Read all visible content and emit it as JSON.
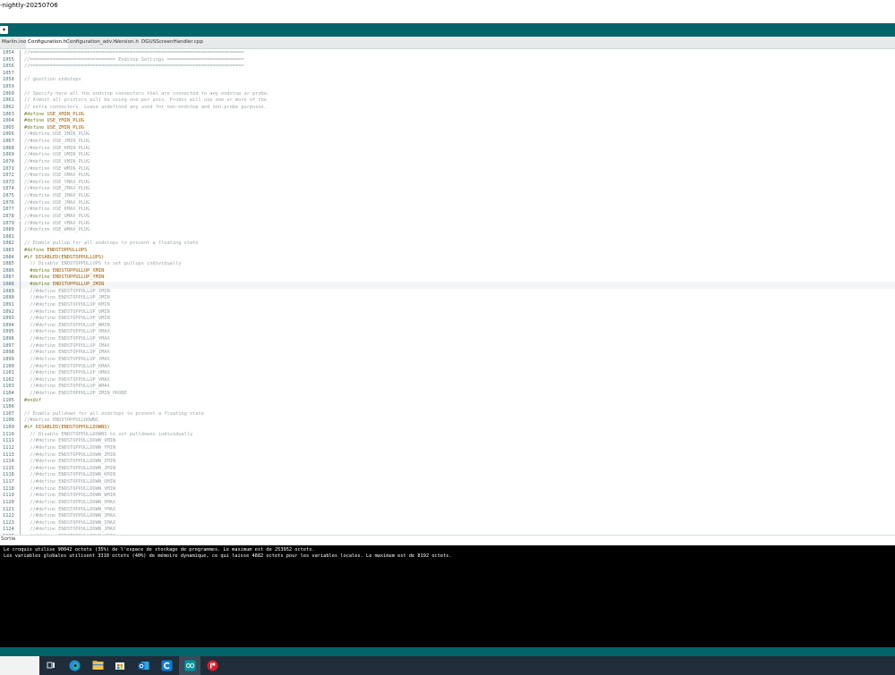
{
  "window": {
    "title": "-nightly-20250706"
  },
  "tabs": [
    {
      "label": "Marlin.ino",
      "active": false
    },
    {
      "label": "Configuration.h",
      "active": true
    },
    {
      "label": "Configuration_adv.h",
      "active": false
    },
    {
      "label": "Version.h",
      "active": false
    },
    {
      "label": "DGUSScreenHandler.cpp",
      "active": false
    }
  ],
  "editor": {
    "highlighted_line": 1088,
    "lines": [
      {
        "n": "1054",
        "text": "//===========================================================================",
        "kind": "cmt"
      },
      {
        "n": "1055",
        "text": "//============================== Endstop Settings ===========================",
        "kind": "cmt"
      },
      {
        "n": "1056",
        "text": "//===========================================================================",
        "kind": "cmt"
      },
      {
        "n": "1057",
        "text": "",
        "kind": "cmt"
      },
      {
        "n": "1058",
        "text": "// @section endstops",
        "kind": "cmt"
      },
      {
        "n": "1059",
        "text": "",
        "kind": "cmt"
      },
      {
        "n": "1060",
        "text": "// Specify here all the endstop connectors that are connected to any endstop or probe.",
        "kind": "cmt"
      },
      {
        "n": "1061",
        "text": "// Almost all printers will be using one per axis. Probes will use one or more of the",
        "kind": "cmt"
      },
      {
        "n": "1062",
        "text": "// extra connectors. Leave undefined any used for non-endstop and non-probe purposes.",
        "kind": "cmt"
      },
      {
        "n": "1063",
        "text": "#define USE_XMIN_PLUG",
        "kind": "def"
      },
      {
        "n": "1064",
        "text": "#define USE_YMIN_PLUG",
        "kind": "def"
      },
      {
        "n": "1065",
        "text": "#define USE_ZMIN_PLUG",
        "kind": "def"
      },
      {
        "n": "1066",
        "text": "//#define USE_IMIN_PLUG",
        "kind": "cmt"
      },
      {
        "n": "1067",
        "text": "//#define USE_JMIN_PLUG",
        "kind": "cmt"
      },
      {
        "n": "1068",
        "text": "//#define USE_KMIN_PLUG",
        "kind": "cmt"
      },
      {
        "n": "1069",
        "text": "//#define USE_UMIN_PLUG",
        "kind": "cmt"
      },
      {
        "n": "1070",
        "text": "//#define USE_VMIN_PLUG",
        "kind": "cmt"
      },
      {
        "n": "1071",
        "text": "//#define USE_WMIN_PLUG",
        "kind": "cmt"
      },
      {
        "n": "1072",
        "text": "//#define USE_XMAX_PLUG",
        "kind": "cmt"
      },
      {
        "n": "1073",
        "text": "//#define USE_YMAX_PLUG",
        "kind": "cmt"
      },
      {
        "n": "1074",
        "text": "//#define USE_ZMAX_PLUG",
        "kind": "cmt"
      },
      {
        "n": "1075",
        "text": "//#define USE_IMAX_PLUG",
        "kind": "cmt"
      },
      {
        "n": "1076",
        "text": "//#define USE_JMAX_PLUG",
        "kind": "cmt"
      },
      {
        "n": "1077",
        "text": "//#define USE_KMAX_PLUG",
        "kind": "cmt"
      },
      {
        "n": "1078",
        "text": "//#define USE_UMAX_PLUG",
        "kind": "cmt"
      },
      {
        "n": "1079",
        "text": "//#define USE_VMAX_PLUG",
        "kind": "cmt"
      },
      {
        "n": "1080",
        "text": "//#define USE_WMAX_PLUG",
        "kind": "cmt"
      },
      {
        "n": "1081",
        "text": "",
        "kind": "cmt"
      },
      {
        "n": "1082",
        "text": "// Enable pullup for all endstops to prevent a floating state",
        "kind": "cmt"
      },
      {
        "n": "1083",
        "text": "#define ENDSTOPPULLUPS",
        "kind": "def"
      },
      {
        "n": "1084",
        "text": "#if DISABLED(ENDSTOPPULLUPS)",
        "kind": "def"
      },
      {
        "n": "1085",
        "text": "  // Disable ENDSTOPPULLUPS to set pullups individually",
        "kind": "cmt"
      },
      {
        "n": "1086",
        "text": "  #define ENDSTOPPULLUP_XMIN",
        "kind": "def"
      },
      {
        "n": "1087",
        "text": "  #define ENDSTOPPULLUP_YMIN",
        "kind": "def"
      },
      {
        "n": "1088",
        "text": "  #define ENDSTOPPULLUP_ZMIN",
        "kind": "def"
      },
      {
        "n": "1089",
        "text": "  //#define ENDSTOPPULLUP_IMIN",
        "kind": "cmt"
      },
      {
        "n": "1090",
        "text": "  //#define ENDSTOPPULLUP_JMIN",
        "kind": "cmt"
      },
      {
        "n": "1091",
        "text": "  //#define ENDSTOPPULLUP_KMIN",
        "kind": "cmt"
      },
      {
        "n": "1092",
        "text": "  //#define ENDSTOPPULLUP_UMIN",
        "kind": "cmt"
      },
      {
        "n": "1093",
        "text": "  //#define ENDSTOPPULLUP_VMIN",
        "kind": "cmt"
      },
      {
        "n": "1094",
        "text": "  //#define ENDSTOPPULLUP_WMIN",
        "kind": "cmt"
      },
      {
        "n": "1095",
        "text": "  //#define ENDSTOPPULLUP_XMAX",
        "kind": "cmt"
      },
      {
        "n": "1096",
        "text": "  //#define ENDSTOPPULLUP_YMAX",
        "kind": "cmt"
      },
      {
        "n": "1097",
        "text": "  //#define ENDSTOPPULLUP_ZMAX",
        "kind": "cmt"
      },
      {
        "n": "1098",
        "text": "  //#define ENDSTOPPULLUP_IMAX",
        "kind": "cmt"
      },
      {
        "n": "1099",
        "text": "  //#define ENDSTOPPULLUP_JMAX",
        "kind": "cmt"
      },
      {
        "n": "1100",
        "text": "  //#define ENDSTOPPULLUP_KMAX",
        "kind": "cmt"
      },
      {
        "n": "1101",
        "text": "  //#define ENDSTOPPULLUP_UMAX",
        "kind": "cmt"
      },
      {
        "n": "1102",
        "text": "  //#define ENDSTOPPULLUP_VMAX",
        "kind": "cmt"
      },
      {
        "n": "1103",
        "text": "  //#define ENDSTOPPULLUP_WMAX",
        "kind": "cmt"
      },
      {
        "n": "1104",
        "text": "  //#define ENDSTOPPULLUP_ZMIN_PROBE",
        "kind": "cmt"
      },
      {
        "n": "1105",
        "text": "#endif",
        "kind": "def"
      },
      {
        "n": "1106",
        "text": "",
        "kind": "cmt"
      },
      {
        "n": "1107",
        "text": "// Enable pulldown for all endstops to prevent a floating state",
        "kind": "cmt"
      },
      {
        "n": "1108",
        "text": "//#define ENDSTOPPULLDOWNS",
        "kind": "cmt"
      },
      {
        "n": "1109",
        "text": "#if DISABLED(ENDSTOPPULLDOWNS)",
        "kind": "def"
      },
      {
        "n": "1110",
        "text": "  // Disable ENDSTOPPULLDOWNS to set pulldowns individually",
        "kind": "cmt"
      },
      {
        "n": "1111",
        "text": "  //#define ENDSTOPPULLDOWN_XMIN",
        "kind": "cmt"
      },
      {
        "n": "1112",
        "text": "  //#define ENDSTOPPULLDOWN_YMIN",
        "kind": "cmt"
      },
      {
        "n": "1113",
        "text": "  //#define ENDSTOPPULLDOWN_ZMIN",
        "kind": "cmt"
      },
      {
        "n": "1114",
        "text": "  //#define ENDSTOPPULLDOWN_IMIN",
        "kind": "cmt"
      },
      {
        "n": "1115",
        "text": "  //#define ENDSTOPPULLDOWN_JMIN",
        "kind": "cmt"
      },
      {
        "n": "1116",
        "text": "  //#define ENDSTOPPULLDOWN_KMIN",
        "kind": "cmt"
      },
      {
        "n": "1117",
        "text": "  //#define ENDSTOPPULLDOWN_UMIN",
        "kind": "cmt"
      },
      {
        "n": "1118",
        "text": "  //#define ENDSTOPPULLDOWN_VMIN",
        "kind": "cmt"
      },
      {
        "n": "1119",
        "text": "  //#define ENDSTOPPULLDOWN_WMIN",
        "kind": "cmt"
      },
      {
        "n": "1120",
        "text": "  //#define ENDSTOPPULLDOWN_XMAX",
        "kind": "cmt"
      },
      {
        "n": "1121",
        "text": "  //#define ENDSTOPPULLDOWN_YMAX",
        "kind": "cmt"
      },
      {
        "n": "1122",
        "text": "  //#define ENDSTOPPULLDOWN_ZMAX",
        "kind": "cmt"
      },
      {
        "n": "1123",
        "text": "  //#define ENDSTOPPULLDOWN_IMAX",
        "kind": "cmt"
      },
      {
        "n": "1124",
        "text": "  //#define ENDSTOPPULLDOWN_JMAX",
        "kind": "cmt"
      },
      {
        "n": "1125",
        "text": "  //#define ENDSTOPPULLDOWN_KMAX",
        "kind": "cmt"
      }
    ]
  },
  "output": {
    "label": "Sortie",
    "messages": [
      "Le croquis utilise 90042 octets (35%) de l'espace de stockage de programmes. Le maximum est de 253952 octets.",
      "Les variables globales utilisent 3310 octets (40%) de mémoire dynamique, ce qui laisse 4882 octets pour les variables locales. Le maximum est de 8192 octets."
    ]
  },
  "toolbar": {
    "dropdown_glyph": "▾"
  },
  "taskbar": {
    "icons": [
      "task-view-icon",
      "edge-icon",
      "file-explorer-icon",
      "store-icon",
      "outlook-icon",
      "cortana-icon",
      "arduino-icon",
      "app-red-icon"
    ]
  },
  "colors": {
    "teal": "#006468",
    "preprocessor": "#6a7d1a",
    "macro": "#a05a00",
    "comment": "#9aa5a8",
    "line_number": "#4a6f78"
  }
}
